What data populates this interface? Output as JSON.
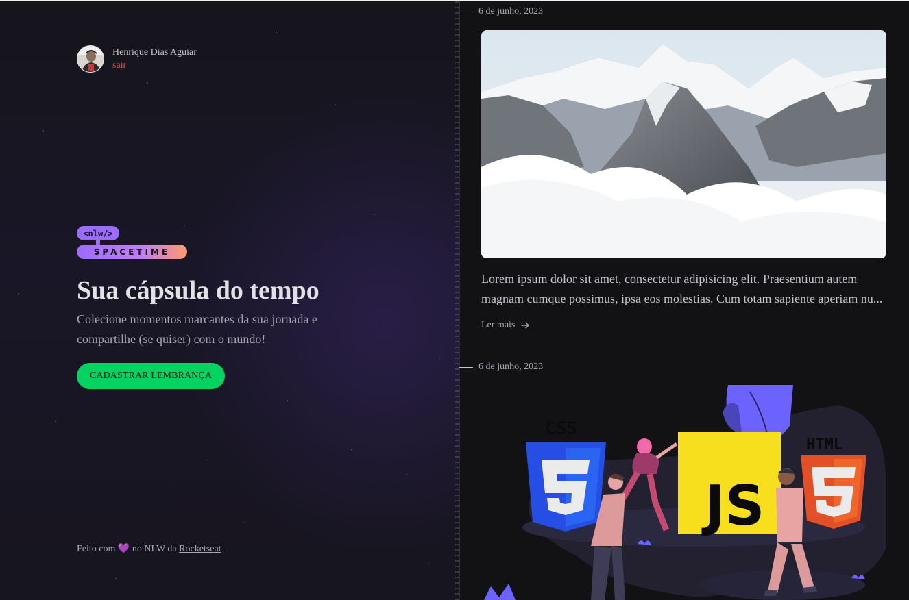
{
  "user": {
    "name": "Henrique Dias Aguiar",
    "logout_label": "sair"
  },
  "brand": {
    "badge_text": "<nlw/>",
    "wordmark": "SPACETIME"
  },
  "hero": {
    "title": "Sua cápsula do tempo",
    "subtitle": "Colecione momentos marcantes da sua jornada e compartilhe (se quiser) com o mundo!",
    "cta_label": "CADASTRAR LEMBRANÇA"
  },
  "footer": {
    "prefix": "Feito com",
    "heart": "💜",
    "middle": "no NLW da",
    "link": "Rocketseat"
  },
  "memories": [
    {
      "date": "6 de junho, 2023",
      "excerpt": "Lorem ipsum dolor sit amet, consectetur adipisicing elit. Praesentium autem magnam cumque possimus, ipsa eos molestias. Cum totam sapiente aperiam nu...",
      "read_more": "Ler mais"
    },
    {
      "date": "6 de junho, 2023",
      "image_labels": {
        "css": "CSS",
        "js": "JS",
        "html": "HTML"
      }
    }
  ],
  "colors": {
    "accent_green": "#04d361",
    "logout_red": "#e5484d",
    "brand_purple": "#9b6cff",
    "brand_orange": "#ff9a6b"
  },
  "icons": [
    "arrow-right-icon",
    "avatar",
    "heart-icon"
  ]
}
